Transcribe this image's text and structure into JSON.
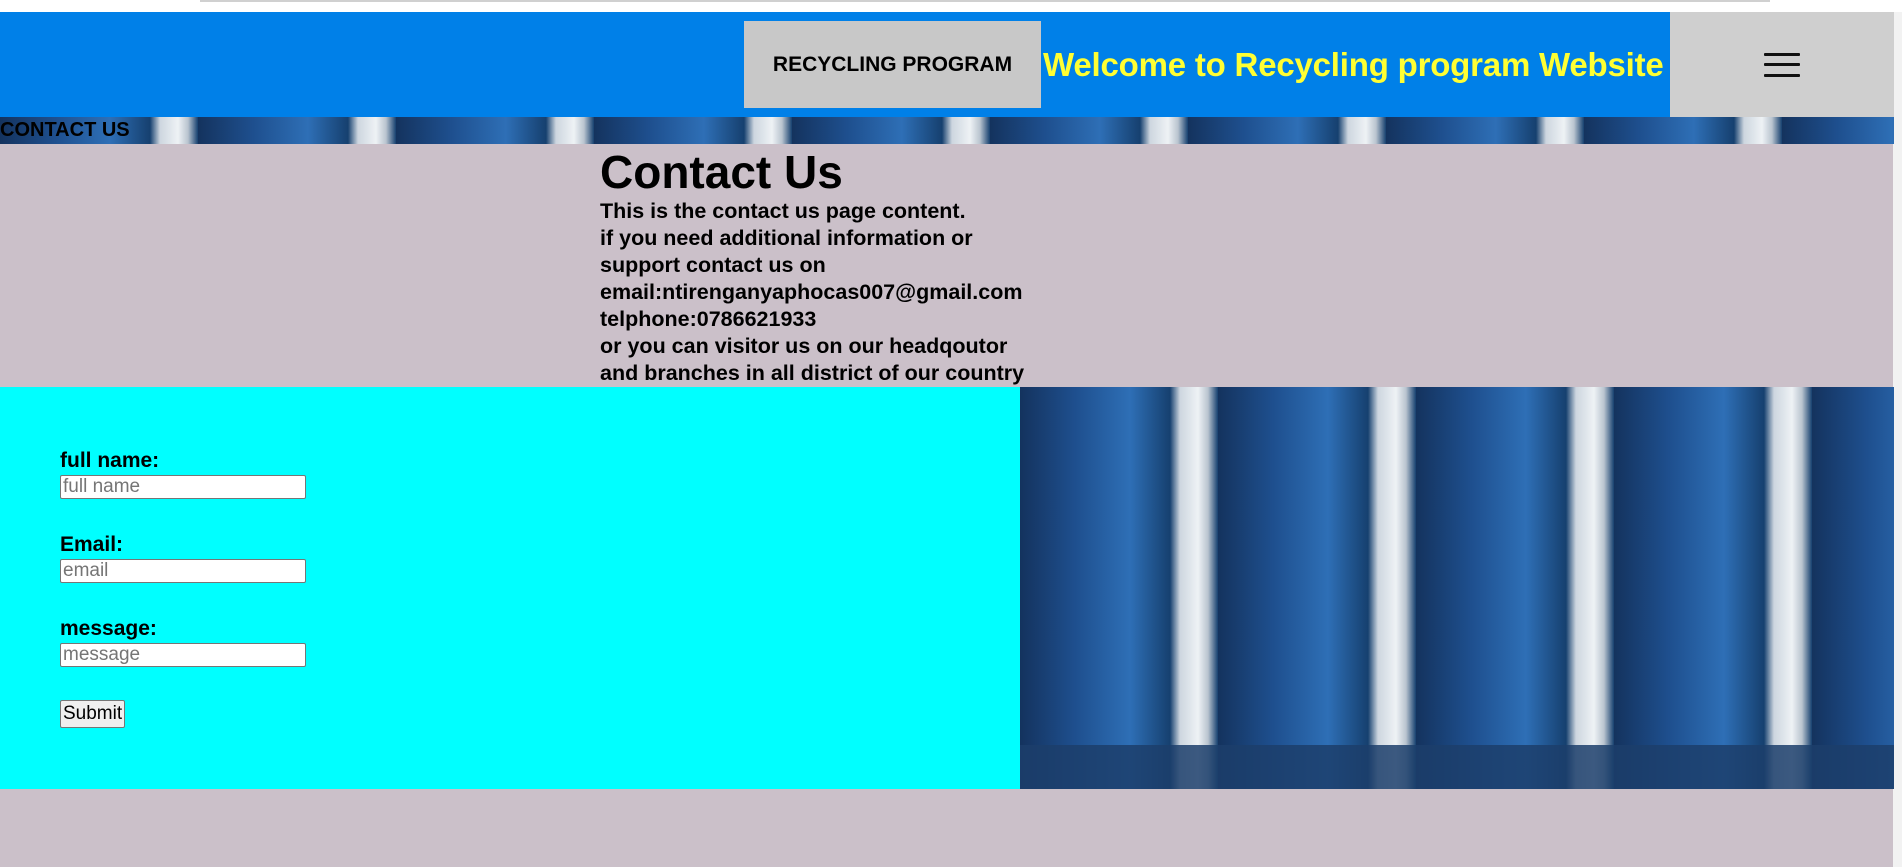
{
  "header": {
    "brand": "RECYCLING PROGRAM",
    "welcome": "Welcome to Recycling program Website",
    "menu_icon": "hamburger-menu-icon"
  },
  "banner": {
    "label": "CONTACT US"
  },
  "content": {
    "title": "Contact Us",
    "lines": [
      "This is the contact us page content.",
      "if you need additional information or",
      "support contact us on",
      "email:ntirenganyaphocas007@gmail.com",
      "telphone:0786621933",
      "or you can visitor us on our headqoutor",
      "and branches in all district of our country"
    ]
  },
  "form": {
    "fullname_label": "full name:",
    "fullname_placeholder": "full name",
    "email_label": "Email:",
    "email_placeholder": "email",
    "message_label": "message:",
    "message_placeholder": "message",
    "submit": "Submit"
  },
  "colors": {
    "header": "#0080e8",
    "welcome_text": "#ffff33",
    "page_bg": "#cbc0c9",
    "form_bg": "#00ffff"
  }
}
